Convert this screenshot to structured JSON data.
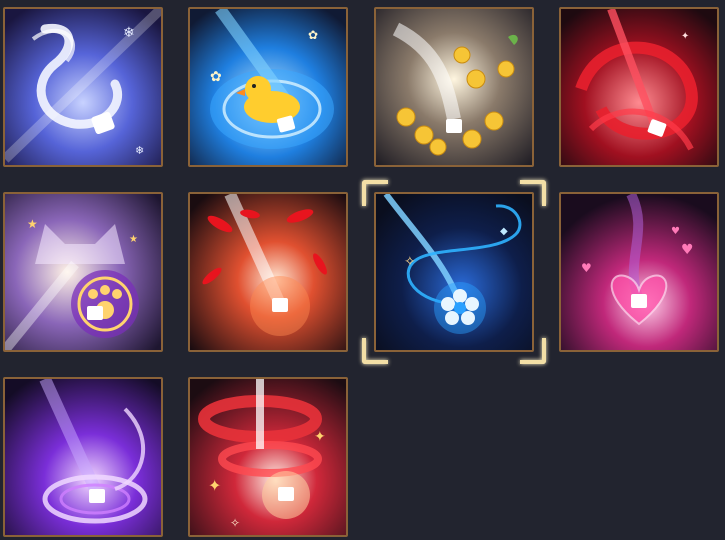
{
  "grid": {
    "background": "#22242f",
    "frame_color": "#8a6238",
    "selected_index": 6,
    "selector_color": "#f3dfa6"
  },
  "effects": [
    {
      "icon": "white-serpent-effect-icon",
      "theme": "#6a7cf0"
    },
    {
      "icon": "rubber-duck-splash-effect-icon",
      "theme": "#2aa0ff"
    },
    {
      "icon": "golden-blossom-effect-icon",
      "theme": "#f2c94c"
    },
    {
      "icon": "crimson-ribbon-effect-icon",
      "theme": "#e0303a"
    },
    {
      "icon": "cat-paw-effect-icon",
      "theme": "#b06be0"
    },
    {
      "icon": "red-feather-burst-effect-icon",
      "theme": "#ff5a3c"
    },
    {
      "icon": "blue-flower-swirl-effect-icon",
      "theme": "#3ab4ff"
    },
    {
      "icon": "pink-heart-effect-icon",
      "theme": "#ff4fa8"
    },
    {
      "icon": "violet-vortex-effect-icon",
      "theme": "#a45cff"
    },
    {
      "icon": "red-spiral-sparkle-effect-icon",
      "theme": "#ff3040"
    }
  ]
}
